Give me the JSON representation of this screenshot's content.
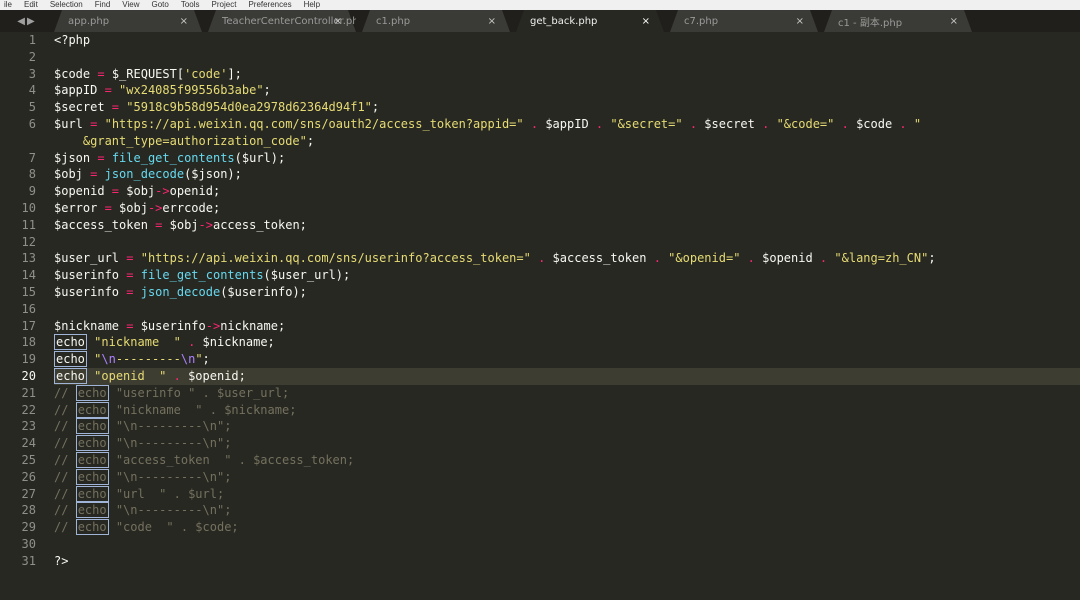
{
  "menubar": [
    "ile",
    "Edit",
    "Selection",
    "Find",
    "View",
    "Goto",
    "Tools",
    "Project",
    "Preferences",
    "Help"
  ],
  "tabs": [
    {
      "label": "app.php",
      "active": false
    },
    {
      "label": "TeacherCenterController.php",
      "active": false
    },
    {
      "label": "c1.php",
      "active": false
    },
    {
      "label": "get_back.php",
      "active": true
    },
    {
      "label": "c7.php",
      "active": false
    },
    {
      "label": "c1 - 副本.php",
      "active": false
    }
  ],
  "tab_close_glyph": "×",
  "nav_arrows": "◀▶",
  "line_numbers": [
    "1",
    "2",
    "3",
    "4",
    "5",
    "6",
    "",
    "7",
    "8",
    "9",
    "10",
    "11",
    "12",
    "13",
    "14",
    "15",
    "16",
    "17",
    "18",
    "19",
    "20",
    "21",
    "22",
    "23",
    "24",
    "25",
    "26",
    "27",
    "28",
    "29",
    "30",
    "31"
  ],
  "current_line_index": 20,
  "code_lines": [
    {
      "cls": "",
      "tokens": [
        {
          "t": "pl",
          "v": "<?php"
        }
      ]
    },
    {
      "cls": "",
      "tokens": []
    },
    {
      "cls": "",
      "tokens": [
        {
          "t": "pl",
          "v": "$code "
        },
        {
          "t": "op",
          "v": "="
        },
        {
          "t": "pl",
          "v": " $_REQUEST["
        },
        {
          "t": "str",
          "v": "'code'"
        },
        {
          "t": "pl",
          "v": "];"
        }
      ]
    },
    {
      "cls": "",
      "tokens": [
        {
          "t": "pl",
          "v": "$appID "
        },
        {
          "t": "op",
          "v": "="
        },
        {
          "t": "pl",
          "v": " "
        },
        {
          "t": "str",
          "v": "\"wx24085f99556b3abe\""
        },
        {
          "t": "pl",
          "v": ";"
        }
      ]
    },
    {
      "cls": "",
      "tokens": [
        {
          "t": "pl",
          "v": "$secret "
        },
        {
          "t": "op",
          "v": "="
        },
        {
          "t": "pl",
          "v": " "
        },
        {
          "t": "str",
          "v": "\"5918c9b58d954d0ea2978d62364d94f1\""
        },
        {
          "t": "pl",
          "v": ";"
        }
      ]
    },
    {
      "cls": "",
      "tokens": [
        {
          "t": "pl",
          "v": "$url "
        },
        {
          "t": "op",
          "v": "="
        },
        {
          "t": "pl",
          "v": " "
        },
        {
          "t": "str",
          "v": "\"https://api.weixin.qq.com/sns/oauth2/access_token?appid=\""
        },
        {
          "t": "pl",
          "v": " "
        },
        {
          "t": "op",
          "v": "."
        },
        {
          "t": "pl",
          "v": " $appID "
        },
        {
          "t": "op",
          "v": "."
        },
        {
          "t": "pl",
          "v": " "
        },
        {
          "t": "str",
          "v": "\"&secret=\""
        },
        {
          "t": "pl",
          "v": " "
        },
        {
          "t": "op",
          "v": "."
        },
        {
          "t": "pl",
          "v": " $secret "
        },
        {
          "t": "op",
          "v": "."
        },
        {
          "t": "pl",
          "v": " "
        },
        {
          "t": "str",
          "v": "\"&code=\""
        },
        {
          "t": "pl",
          "v": " "
        },
        {
          "t": "op",
          "v": "."
        },
        {
          "t": "pl",
          "v": " $code "
        },
        {
          "t": "op",
          "v": "."
        },
        {
          "t": "pl",
          "v": " "
        },
        {
          "t": "str",
          "v": "\""
        }
      ]
    },
    {
      "cls": "",
      "tokens": [
        {
          "t": "pl",
          "v": "    "
        },
        {
          "t": "str",
          "v": "&grant_type=authorization_code\""
        },
        {
          "t": "pl",
          "v": ";"
        }
      ]
    },
    {
      "cls": "",
      "tokens": [
        {
          "t": "pl",
          "v": "$json "
        },
        {
          "t": "op",
          "v": "="
        },
        {
          "t": "pl",
          "v": " "
        },
        {
          "t": "fn",
          "v": "file_get_contents"
        },
        {
          "t": "pl",
          "v": "($url);"
        }
      ]
    },
    {
      "cls": "",
      "tokens": [
        {
          "t": "pl",
          "v": "$obj "
        },
        {
          "t": "op",
          "v": "="
        },
        {
          "t": "pl",
          "v": " "
        },
        {
          "t": "fn",
          "v": "json_decode"
        },
        {
          "t": "pl",
          "v": "($json);"
        }
      ]
    },
    {
      "cls": "",
      "tokens": [
        {
          "t": "pl",
          "v": "$openid "
        },
        {
          "t": "op",
          "v": "="
        },
        {
          "t": "pl",
          "v": " $obj"
        },
        {
          "t": "op",
          "v": "->"
        },
        {
          "t": "pl",
          "v": "openid;"
        }
      ]
    },
    {
      "cls": "",
      "tokens": [
        {
          "t": "pl",
          "v": "$error "
        },
        {
          "t": "op",
          "v": "="
        },
        {
          "t": "pl",
          "v": " $obj"
        },
        {
          "t": "op",
          "v": "->"
        },
        {
          "t": "pl",
          "v": "errcode;"
        }
      ]
    },
    {
      "cls": "",
      "tokens": [
        {
          "t": "pl",
          "v": "$access_token "
        },
        {
          "t": "op",
          "v": "="
        },
        {
          "t": "pl",
          "v": " $obj"
        },
        {
          "t": "op",
          "v": "->"
        },
        {
          "t": "pl",
          "v": "access_token;"
        }
      ]
    },
    {
      "cls": "",
      "tokens": []
    },
    {
      "cls": "",
      "tokens": [
        {
          "t": "pl",
          "v": "$user_url "
        },
        {
          "t": "op",
          "v": "="
        },
        {
          "t": "pl",
          "v": " "
        },
        {
          "t": "str",
          "v": "\"https://api.weixin.qq.com/sns/userinfo?access_token=\""
        },
        {
          "t": "pl",
          "v": " "
        },
        {
          "t": "op",
          "v": "."
        },
        {
          "t": "pl",
          "v": " $access_token "
        },
        {
          "t": "op",
          "v": "."
        },
        {
          "t": "pl",
          "v": " "
        },
        {
          "t": "str",
          "v": "\"&openid=\""
        },
        {
          "t": "pl",
          "v": " "
        },
        {
          "t": "op",
          "v": "."
        },
        {
          "t": "pl",
          "v": " $openid "
        },
        {
          "t": "op",
          "v": "."
        },
        {
          "t": "pl",
          "v": " "
        },
        {
          "t": "str",
          "v": "\"&lang=zh_CN\""
        },
        {
          "t": "pl",
          "v": ";"
        }
      ]
    },
    {
      "cls": "",
      "tokens": [
        {
          "t": "pl",
          "v": "$userinfo "
        },
        {
          "t": "op",
          "v": "="
        },
        {
          "t": "pl",
          "v": " "
        },
        {
          "t": "fn",
          "v": "file_get_contents"
        },
        {
          "t": "pl",
          "v": "($user_url);"
        }
      ]
    },
    {
      "cls": "",
      "tokens": [
        {
          "t": "pl",
          "v": "$userinfo "
        },
        {
          "t": "op",
          "v": "="
        },
        {
          "t": "pl",
          "v": " "
        },
        {
          "t": "fn",
          "v": "json_decode"
        },
        {
          "t": "pl",
          "v": "($userinfo);"
        }
      ]
    },
    {
      "cls": "",
      "tokens": []
    },
    {
      "cls": "",
      "tokens": [
        {
          "t": "pl",
          "v": "$nickname "
        },
        {
          "t": "op",
          "v": "="
        },
        {
          "t": "pl",
          "v": " $userinfo"
        },
        {
          "t": "op",
          "v": "->"
        },
        {
          "t": "pl",
          "v": "nickname;"
        }
      ]
    },
    {
      "cls": "",
      "tokens": [
        {
          "t": "box",
          "v": "echo"
        },
        {
          "t": "pl",
          "v": " "
        },
        {
          "t": "str",
          "v": "\"nickname  \""
        },
        {
          "t": "pl",
          "v": " "
        },
        {
          "t": "op",
          "v": "."
        },
        {
          "t": "pl",
          "v": " $nickname;"
        }
      ]
    },
    {
      "cls": "",
      "tokens": [
        {
          "t": "box",
          "v": "echo"
        },
        {
          "t": "pl",
          "v": " "
        },
        {
          "t": "str",
          "v": "\""
        },
        {
          "t": "esc",
          "v": "\\n"
        },
        {
          "t": "str",
          "v": "---------"
        },
        {
          "t": "esc",
          "v": "\\n"
        },
        {
          "t": "str",
          "v": "\""
        },
        {
          "t": "pl",
          "v": ";"
        }
      ]
    },
    {
      "cls": "highlight-line",
      "tokens": [
        {
          "t": "box",
          "v": "echo"
        },
        {
          "t": "pl",
          "v": " "
        },
        {
          "t": "str",
          "v": "\"openid  \""
        },
        {
          "t": "pl",
          "v": " "
        },
        {
          "t": "op",
          "v": "."
        },
        {
          "t": "pl",
          "v": " $openid;"
        }
      ]
    },
    {
      "cls": "cm-line",
      "tokens": [
        {
          "t": "cm",
          "v": "// "
        },
        {
          "t": "cmbox",
          "v": "echo"
        },
        {
          "t": "cm",
          "v": " \"userinfo \" . $user_url;"
        }
      ]
    },
    {
      "cls": "cm-line",
      "tokens": [
        {
          "t": "cm",
          "v": "// "
        },
        {
          "t": "cmbox",
          "v": "echo"
        },
        {
          "t": "cm",
          "v": " \"nickname  \" . $nickname;"
        }
      ]
    },
    {
      "cls": "cm-line",
      "tokens": [
        {
          "t": "cm",
          "v": "// "
        },
        {
          "t": "cmbox",
          "v": "echo"
        },
        {
          "t": "cm",
          "v": " \"\\n---------\\n\";"
        }
      ]
    },
    {
      "cls": "cm-line",
      "tokens": [
        {
          "t": "cm",
          "v": "// "
        },
        {
          "t": "cmbox",
          "v": "echo"
        },
        {
          "t": "cm",
          "v": " \"\\n---------\\n\";"
        }
      ]
    },
    {
      "cls": "cm-line",
      "tokens": [
        {
          "t": "cm",
          "v": "// "
        },
        {
          "t": "cmbox",
          "v": "echo"
        },
        {
          "t": "cm",
          "v": " \"access_token  \" . $access_token;"
        }
      ]
    },
    {
      "cls": "cm-line",
      "tokens": [
        {
          "t": "cm",
          "v": "// "
        },
        {
          "t": "cmbox",
          "v": "echo"
        },
        {
          "t": "cm",
          "v": " \"\\n---------\\n\";"
        }
      ]
    },
    {
      "cls": "cm-line",
      "tokens": [
        {
          "t": "cm",
          "v": "// "
        },
        {
          "t": "cmbox",
          "v": "echo"
        },
        {
          "t": "cm",
          "v": " \"url  \" . $url;"
        }
      ]
    },
    {
      "cls": "cm-line",
      "tokens": [
        {
          "t": "cm",
          "v": "// "
        },
        {
          "t": "cmbox",
          "v": "echo"
        },
        {
          "t": "cm",
          "v": " \"\\n---------\\n\";"
        }
      ]
    },
    {
      "cls": "cm-line",
      "tokens": [
        {
          "t": "cm",
          "v": "// "
        },
        {
          "t": "cmbox",
          "v": "echo"
        },
        {
          "t": "cm",
          "v": " \"code  \" . $code;"
        }
      ]
    },
    {
      "cls": "",
      "tokens": []
    },
    {
      "cls": "",
      "tokens": [
        {
          "t": "pl",
          "v": "?>"
        }
      ]
    }
  ],
  "colors": {
    "background": "#272822",
    "tabbar": "#201f1b",
    "string": "#e6db74",
    "keyword": "#f92672",
    "function": "#66d9ef",
    "comment": "#75715e",
    "escape": "#ae81ff",
    "text": "#f8f8f2"
  }
}
